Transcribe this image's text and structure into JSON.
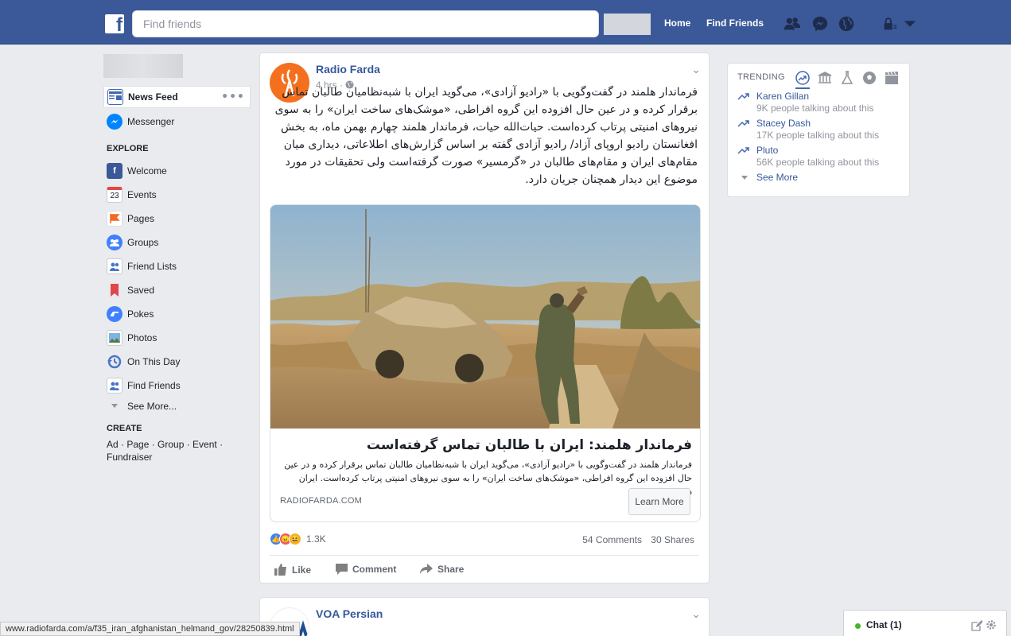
{
  "topbar": {
    "logo_letter": "f",
    "search_placeholder": "Find friends",
    "home_label": "Home",
    "find_friends_label": "Find Friends"
  },
  "sidebar": {
    "items": [
      {
        "label": "News Feed",
        "icon": "news-feed-icon"
      },
      {
        "label": "Messenger",
        "icon": "messenger-icon"
      }
    ],
    "explore_header": "EXPLORE",
    "explore": [
      {
        "label": "Welcome",
        "icon": "welcome-icon"
      },
      {
        "label": "Events",
        "icon": "events-icon",
        "icon_text": "23"
      },
      {
        "label": "Pages",
        "icon": "pages-icon"
      },
      {
        "label": "Groups",
        "icon": "groups-icon"
      },
      {
        "label": "Friend Lists",
        "icon": "friend-lists-icon"
      },
      {
        "label": "Saved",
        "icon": "saved-icon"
      },
      {
        "label": "Pokes",
        "icon": "pokes-icon"
      },
      {
        "label": "Photos",
        "icon": "photos-icon"
      },
      {
        "label": "On This Day",
        "icon": "on-this-day-icon"
      },
      {
        "label": "Find Friends",
        "icon": "find-friends-icon"
      },
      {
        "label": "See More...",
        "icon": "chevron-down-icon"
      }
    ],
    "create_header": "CREATE",
    "create_links": "Ad · Page · Group · Event · Fundraiser"
  },
  "post": {
    "page_name": "Radio Farda",
    "time": "4 hrs · ",
    "text": "فرماندار هلمند در گفت‌وگویی با «رادیو آزادی»، می‌گوید ایران با شبه‌نظامیان طالبان تماس برقرار کرده و در عین حال افزوده این گروه افراطی، «موشک‌های ساخت ایران» را به سوی نیروهای امنیتی پرتاب کرده‌است. حیات‌الله حیات، فرماندار هلمند چهارم بهمن ماه، به بخش افغانستان رادیو اروپای آزاد/ رادیو آزادی گفته بر اساس گزارش‌های اطلاعاتی، دیداری میان مقام‌های ایران و مقام‌های طالبان در «گرمسیر» صورت گرفته‌است ولی تحقیقات در مورد موضوع این دیدار همچنان جریان دارد.",
    "link_title": "فرماندار هلمند: ایران با طالبان تماس گرفته‌است",
    "link_desc": "فرماندار هلمند در گفت‌وگویی با «رادیو آزادی»، می‌گوید ایران با شبه‌نظامیان طالبان تماس برقرار کرده و در عین حال افزوده این گروه افراطی، «موشک‌های ساخت ایران» را به سوی نیروهای امنیتی پرتاب کرده‌است. ایران در...",
    "link_domain": "RADIOFARDA.COM",
    "learn_more": "Learn More",
    "reaction_count": "1.3K",
    "comments": "54 Comments",
    "shares": "30 Shares",
    "like": "Like",
    "comment": "Comment",
    "share": "Share"
  },
  "post2": {
    "page_name": "VOA Persian"
  },
  "trending": {
    "header": "TRENDING",
    "items": [
      {
        "name": "Karen Gillan",
        "sub": "9K people talking about this"
      },
      {
        "name": "Stacey Dash",
        "sub": "17K people talking about this"
      },
      {
        "name": "Pluto",
        "sub": "56K people talking about this"
      }
    ],
    "see_more": "See More"
  },
  "statusbar_url": "www.radiofarda.com/a/f35_iran_afghanistan_helmand_gov/28250839.html",
  "chat_label": "Chat (1)",
  "colors": {
    "brand": "#3b5998",
    "link": "#365899",
    "background": "#e9ebee"
  }
}
